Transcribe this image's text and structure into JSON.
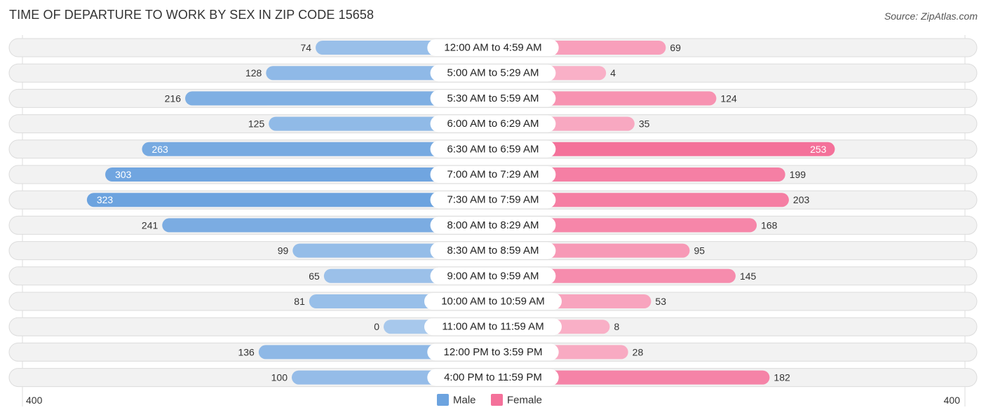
{
  "chart_data": {
    "type": "bar",
    "orientation": "horizontal-diverging",
    "title": "TIME OF DEPARTURE TO WORK BY SEX IN ZIP CODE 15658",
    "source": "Source: ZipAtlas.com",
    "categories": [
      "12:00 AM to 4:59 AM",
      "5:00 AM to 5:29 AM",
      "5:30 AM to 5:59 AM",
      "6:00 AM to 6:29 AM",
      "6:30 AM to 6:59 AM",
      "7:00 AM to 7:29 AM",
      "7:30 AM to 7:59 AM",
      "8:00 AM to 8:29 AM",
      "8:30 AM to 8:59 AM",
      "9:00 AM to 9:59 AM",
      "10:00 AM to 10:59 AM",
      "11:00 AM to 11:59 AM",
      "12:00 PM to 3:59 PM",
      "4:00 PM to 11:59 PM"
    ],
    "series": [
      {
        "name": "Male",
        "color": "#6ca3df",
        "values": [
          74,
          128,
          216,
          125,
          263,
          303,
          323,
          241,
          99,
          65,
          81,
          0,
          136,
          100
        ]
      },
      {
        "name": "Female",
        "color": "#f4719a",
        "values": [
          69,
          4,
          124,
          35,
          253,
          199,
          203,
          168,
          95,
          145,
          53,
          8,
          28,
          182
        ]
      }
    ],
    "axis": {
      "left_label": "400",
      "right_label": "400",
      "range": [
        0,
        400
      ]
    },
    "legend": {
      "position": "bottom-center",
      "items": [
        "Male",
        "Female"
      ]
    }
  }
}
